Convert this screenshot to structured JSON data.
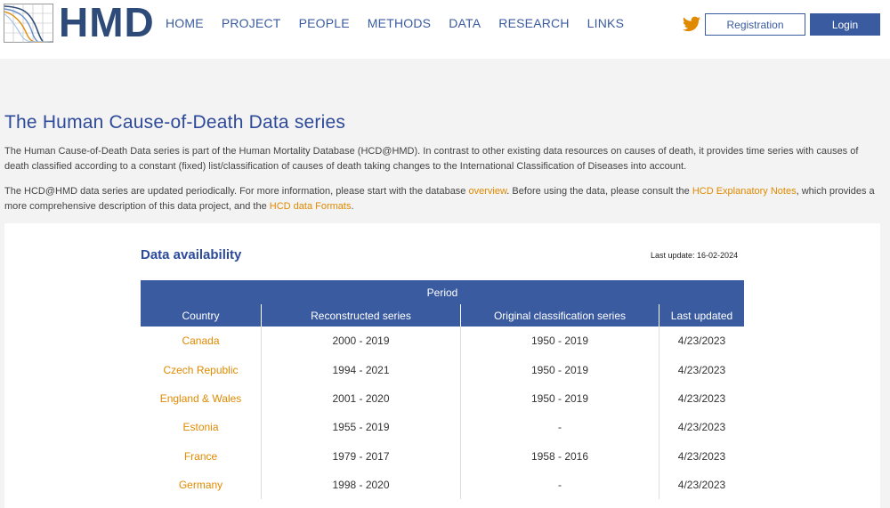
{
  "header": {
    "logo_text": "HMD",
    "nav": [
      "HOME",
      "PROJECT",
      "PEOPLE",
      "METHODS",
      "DATA",
      "RESEARCH",
      "LINKS"
    ],
    "registration_label": "Registration",
    "login_label": "Login",
    "twitter_icon": "twitter-icon"
  },
  "main": {
    "title": "The Human Cause-of-Death Data series",
    "p1": "The Human Cause-of-Death Data series is part of the Human Mortality Database (HCD@HMD). In contrast to other existing data resources on causes of death, it provides time series with causes of death classified according to a constant (fixed) list/classification of causes of death taking changes to the International Classification of Diseases into account.",
    "p2_a": "The HCD@HMD data series are updated periodically. For more information, please start with the database ",
    "p2_link1": "overview",
    "p2_b": ". Before using the data, please consult the ",
    "p2_link2": "HCD Explanatory Notes",
    "p2_c": ", which provides a more comprehensive description of this data project, and the ",
    "p2_link3": "HCD data Formats",
    "p2_d": "."
  },
  "availability": {
    "title": "Data availability",
    "last_update": "Last update: 16-02-2024",
    "period_label": "Period",
    "columns": [
      "Country",
      "Reconstructed series",
      "Original classification series",
      "Last updated"
    ],
    "rows": [
      {
        "country": "Canada",
        "reconstructed": "2000 - 2019",
        "original": "1950 - 2019",
        "updated": "4/23/2023"
      },
      {
        "country": "Czech Republic",
        "reconstructed": "1994 - 2021",
        "original": "1950 - 2019",
        "updated": "4/23/2023"
      },
      {
        "country": "England & Wales",
        "reconstructed": "2001 - 2020",
        "original": "1950 - 2019",
        "updated": "4/23/2023"
      },
      {
        "country": "Estonia",
        "reconstructed": "1955 - 2019",
        "original": "-",
        "updated": "4/23/2023"
      },
      {
        "country": "France",
        "reconstructed": "1979 - 2017",
        "original": "1958 - 2016",
        "updated": "4/23/2023"
      },
      {
        "country": "Germany",
        "reconstructed": "1998 - 2020",
        "original": "-",
        "updated": "4/23/2023"
      }
    ]
  },
  "colors": {
    "brand_blue": "#3a5ba0",
    "link_orange": "#e08a00",
    "title_blue": "#2d4a9a"
  }
}
